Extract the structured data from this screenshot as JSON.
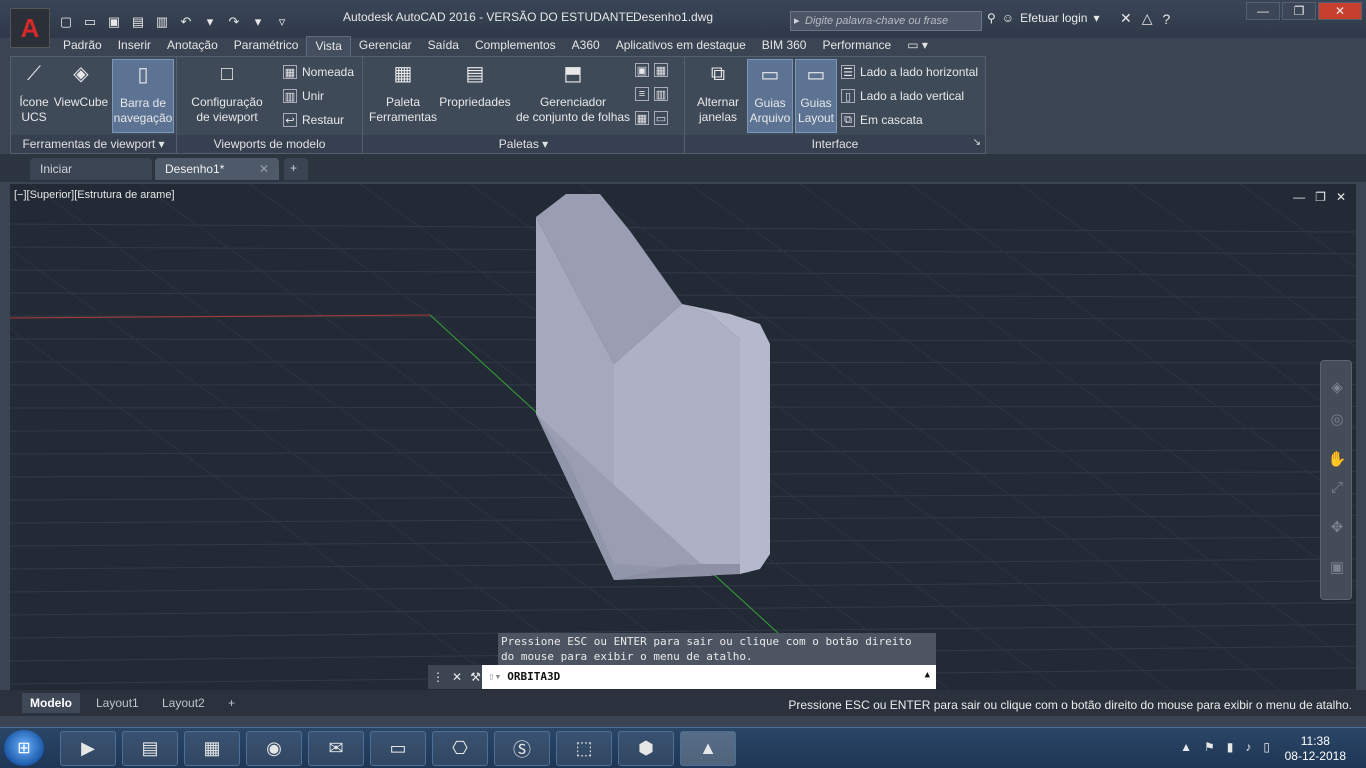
{
  "titlebar": {
    "app_title": "Autodesk AutoCAD 2016 - VERSÃO DO ESTUDANTE",
    "doc_title": "Desenho1.dwg",
    "search_placeholder": "Digite palavra-chave ou frase",
    "login_label": "Efetuar login"
  },
  "ribbon_tabs": [
    "Padrão",
    "Inserir",
    "Anotação",
    "Paramétrico",
    "Vista",
    "Gerenciar",
    "Saída",
    "Complementos",
    "A360",
    "Aplicativos em destaque",
    "BIM 360",
    "Performance"
  ],
  "ribbon": {
    "ferramentas": {
      "title": "Ferramentas de viewport",
      "icone_ucs": [
        "Ícone",
        "UCS"
      ],
      "viewcube": "ViewCube",
      "barra_nav": [
        "Barra de",
        "navegação"
      ]
    },
    "viewports": {
      "title": "Viewports de modelo",
      "config": [
        "Configuração",
        "de viewport"
      ],
      "nomeada": "Nomeada",
      "unir": "Unir",
      "restaur": "Restaur"
    },
    "paletas": {
      "title": "Paletas",
      "paleta": [
        "Paleta",
        "Ferramentas"
      ],
      "propriedades": "Propriedades",
      "gerenciador": [
        "Gerenciador",
        "de conjunto de folhas"
      ]
    },
    "interface": {
      "title": "Interface",
      "alternar": [
        "Alternar",
        "janelas"
      ],
      "guias_arquivo": [
        "Guias",
        "Arquivo"
      ],
      "guias_layout": [
        "Guias",
        "Layout"
      ],
      "horizontal": "Lado a lado horizontal",
      "vertical": "Lado a lado vertical",
      "cascata": "Em cascata"
    }
  },
  "file_tabs": {
    "iniciar": "Iniciar",
    "desenho": "Desenho1*"
  },
  "viewport": {
    "label": "[−][Superior][Estrutura de arame]"
  },
  "command": {
    "tooltip_line1": "Pressione ESC ou ENTER para sair ou clique com o botão direito",
    "tooltip_line2": "do mouse para exibir o menu de atalho.",
    "input_value": "ORBITA3D"
  },
  "layout_tabs": [
    "Modelo",
    "Layout1",
    "Layout2"
  ],
  "status": {
    "message": "Pressione ESC ou ENTER para sair ou clique com o botão direito do mouse para exibir o menu de atalho."
  },
  "taskbar": {
    "time": "11:38",
    "date": "08-12-2018"
  },
  "colors": {
    "viewport_bg": "#222a35",
    "solid_light": "#a9acbf",
    "solid_dark": "#8e91a6",
    "axis_red": "#b03a3a",
    "axis_green": "#3aa03a"
  }
}
